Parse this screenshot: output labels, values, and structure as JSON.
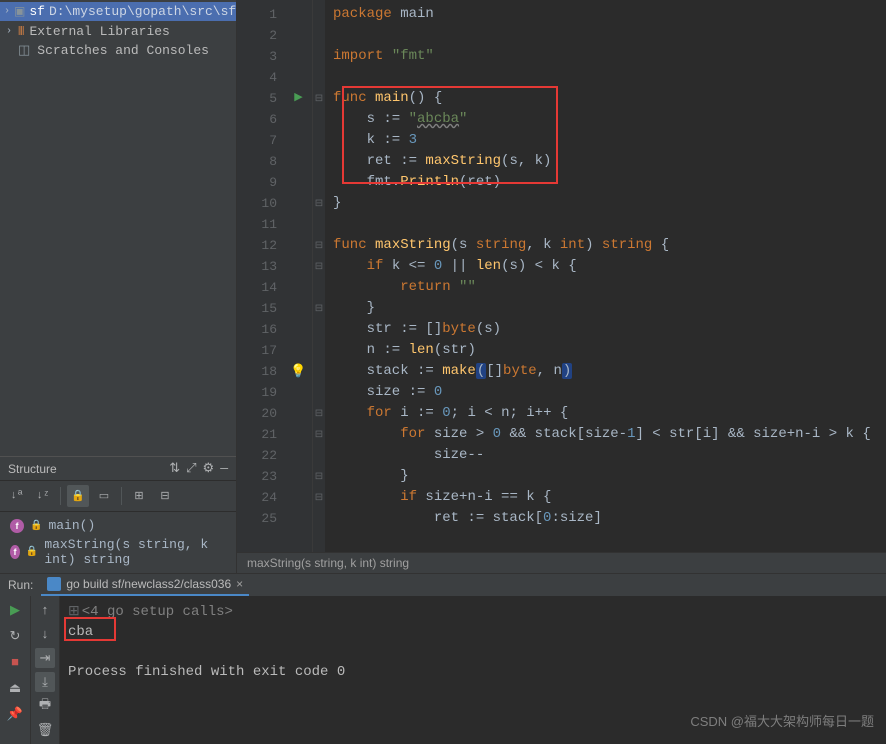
{
  "project": {
    "root_name": "sf",
    "root_path": "D:\\mysetup\\gopath\\src\\sf",
    "external_libs": "External Libraries",
    "scratches": "Scratches and Consoles"
  },
  "structure": {
    "title": "Structure",
    "items": [
      {
        "name": "main()",
        "icon": "f"
      },
      {
        "name": "maxString(s string, k int) string",
        "icon": "f"
      }
    ]
  },
  "editor": {
    "breadcrumb": "maxString(s string, k int) string",
    "lines": [
      {
        "n": 1,
        "html": "<span class='kw'>package</span> <span class='pkg'>main</span>"
      },
      {
        "n": 2,
        "html": ""
      },
      {
        "n": 3,
        "html": "<span class='kw'>import</span> <span class='str'>\"fmt\"</span>"
      },
      {
        "n": 4,
        "html": ""
      },
      {
        "n": 5,
        "html": "<span class='kw'>func</span> <span class='fn'>main</span>() {",
        "run": true,
        "fold": "-"
      },
      {
        "n": 6,
        "html": "    s := <span class='str'>\"<span class='underline'>abcba</span>\"</span>"
      },
      {
        "n": 7,
        "html": "    k := <span class='num'>3</span>"
      },
      {
        "n": 8,
        "html": "    ret := <span class='fn'>maxString</span>(s, k)"
      },
      {
        "n": 9,
        "html": "    fmt.<span class='fn'>Println</span>(ret)"
      },
      {
        "n": 10,
        "html": "}",
        "fold": "-"
      },
      {
        "n": 11,
        "html": ""
      },
      {
        "n": 12,
        "html": "<span class='kw'>func</span> <span class='fn'>maxString</span>(s <span class='kw'>string</span>, k <span class='kw'>int</span>) <span class='kw'>string</span> {",
        "fold": "-"
      },
      {
        "n": 13,
        "html": "    <span class='kw'>if</span> k &lt;= <span class='num'>0</span> || <span class='fn'>len</span>(s) &lt; k {",
        "fold": "-"
      },
      {
        "n": 14,
        "html": "        <span class='kw'>return</span> <span class='str'>\"\"</span>"
      },
      {
        "n": 15,
        "html": "    }",
        "fold": "-"
      },
      {
        "n": 16,
        "html": "    str := []<span class='kw'>byte</span>(s)"
      },
      {
        "n": 17,
        "html": "    n := <span class='fn'>len</span>(str)"
      },
      {
        "n": 18,
        "html": "    stack := <span class='fn'>make</span><span class='caret-hl'>(</span>[]<span class='kw'>byte</span>, n<span class='caret-hl'>)</span>",
        "bulb": true
      },
      {
        "n": 19,
        "html": "    size := <span class='num'>0</span>"
      },
      {
        "n": 20,
        "html": "    <span class='kw'>for</span> i := <span class='num'>0</span>; i &lt; n; i++ {",
        "fold": "-"
      },
      {
        "n": 21,
        "html": "        <span class='kw'>for</span> size &gt; <span class='num'>0</span> &amp;&amp; stack[size-<span class='num'>1</span>] &lt; str[i] &amp;&amp; size+n-i &gt; k {",
        "fold": "-"
      },
      {
        "n": 22,
        "html": "            size--"
      },
      {
        "n": 23,
        "html": "        }",
        "fold": "-"
      },
      {
        "n": 24,
        "html": "        <span class='kw'>if</span> size+n-i == k {",
        "fold": "-"
      },
      {
        "n": 25,
        "html": "            ret := stack[<span class='num'>0</span>:size]"
      }
    ]
  },
  "run": {
    "label": "Run:",
    "tab": "go build sf/newclass2/class036",
    "console": [
      {
        "text": "<4 go setup calls>",
        "fold": true
      },
      {
        "text": "cba"
      },
      {
        "text": ""
      },
      {
        "text": "Process finished with exit code 0"
      }
    ]
  },
  "watermark": "CSDN @福大大架构师每日一题"
}
